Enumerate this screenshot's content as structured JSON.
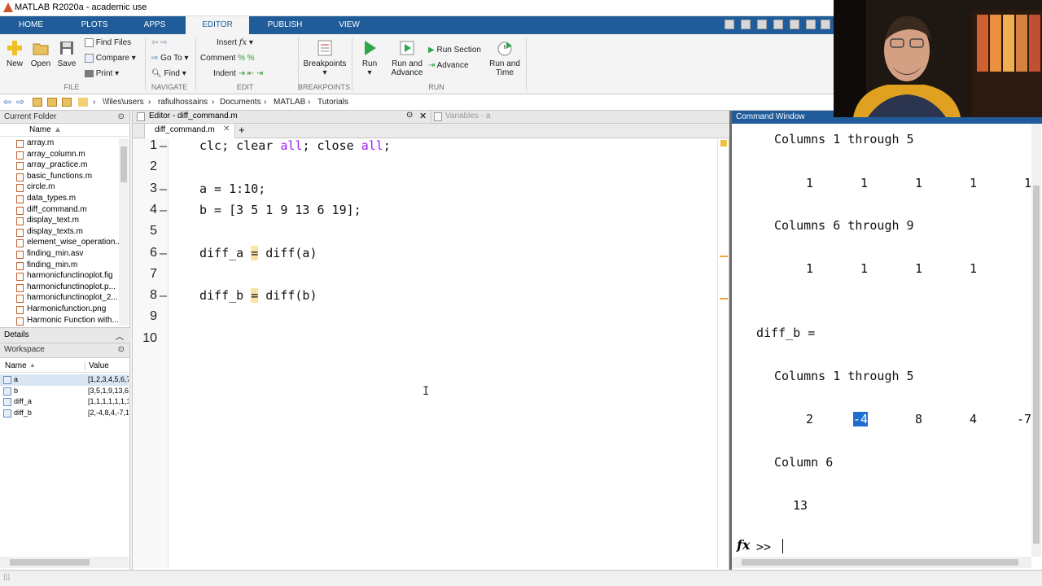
{
  "window": {
    "title": "MATLAB R2020a - academic use"
  },
  "tabs": [
    {
      "label": "HOME",
      "active": false
    },
    {
      "label": "PLOTS",
      "active": false
    },
    {
      "label": "APPS",
      "active": false
    },
    {
      "label": "EDITOR",
      "active": true
    },
    {
      "label": "PUBLISH",
      "active": false
    },
    {
      "label": "VIEW",
      "active": false
    }
  ],
  "ribbon": {
    "file": {
      "new": "New",
      "open": "Open",
      "save": "Save",
      "find_files": "Find Files",
      "compare": "Compare",
      "print": "Print",
      "group": "FILE"
    },
    "navigate": {
      "go_to": "Go To",
      "find": "Find",
      "group": "NAVIGATE"
    },
    "edit": {
      "insert": "Insert",
      "comment": "Comment",
      "indent": "Indent",
      "group": "EDIT"
    },
    "breakpoints": {
      "label": "Breakpoints",
      "group": "BREAKPOINTS"
    },
    "run": {
      "run": "Run",
      "run_advance_1": "Run and",
      "run_advance_2": "Advance",
      "run_section": "Run Section",
      "advance": "Advance",
      "run_time_1": "Run and",
      "run_time_2": "Time",
      "group": "RUN"
    }
  },
  "address": {
    "path": [
      "\\\\files\\users",
      "rafiulhossains",
      "Documents",
      "MATLAB",
      "Tutorials"
    ]
  },
  "current_folder": {
    "title": "Current Folder",
    "column": "Name",
    "files": [
      "array.m",
      "array_column.m",
      "array_practice.m",
      "basic_functions.m",
      "circle.m",
      "data_types.m",
      "diff_command.m",
      "display_text.m",
      "display_texts.m",
      "element_wise_operation...",
      "finding_min.asv",
      "finding_min.m",
      "harmonicfunctinoplot.fig",
      "harmonicfunctinoplot.p...",
      "harmonicfunctinoplot_2...",
      "Harmonicfunction.png",
      "Harmonic Function with..."
    ]
  },
  "details": {
    "title": "Details"
  },
  "workspace": {
    "title": "Workspace",
    "col_name": "Name",
    "col_value": "Value",
    "vars": [
      {
        "name": "a",
        "value": "[1,2,3,4,5,6,7"
      },
      {
        "name": "b",
        "value": "[3,5,1,9,13,6"
      },
      {
        "name": "diff_a",
        "value": "[1,1,1,1,1,1,1"
      },
      {
        "name": "diff_b",
        "value": "[2,-4,8,4,-7,1"
      }
    ]
  },
  "editor": {
    "header": "Editor - diff_command.m",
    "variables_tab": "Variables - a",
    "file_tab": "diff_command.m",
    "lines": [
      {
        "num": "1",
        "dash": "—",
        "parts": [
          {
            "t": "clc; clear "
          },
          {
            "t": "all",
            "c": "kw"
          },
          {
            "t": "; close "
          },
          {
            "t": "all",
            "c": "kw"
          },
          {
            "t": ";"
          }
        ]
      },
      {
        "num": "2",
        "dash": "",
        "parts": []
      },
      {
        "num": "3",
        "dash": "—",
        "parts": [
          {
            "t": "a = 1:10;"
          }
        ]
      },
      {
        "num": "4",
        "dash": "—",
        "parts": [
          {
            "t": "b = [3 5 1 9 13 6 19];"
          }
        ]
      },
      {
        "num": "5",
        "dash": "",
        "parts": []
      },
      {
        "num": "6",
        "dash": "—",
        "parts": [
          {
            "t": "diff_a "
          },
          {
            "t": "=",
            "c": "hl"
          },
          {
            "t": " diff(a)"
          }
        ]
      },
      {
        "num": "7",
        "dash": "",
        "parts": []
      },
      {
        "num": "8",
        "dash": "—",
        "parts": [
          {
            "t": "diff_b "
          },
          {
            "t": "=",
            "c": "hl"
          },
          {
            "t": " diff(b)"
          }
        ]
      },
      {
        "num": "9",
        "dash": "",
        "parts": []
      },
      {
        "num": "10",
        "dash": "",
        "parts": []
      }
    ]
  },
  "command_window": {
    "title": "Command Window",
    "cols_1_5_a": "Columns 1 through 5",
    "row_a1": [
      "1",
      "1",
      "1",
      "1",
      "1"
    ],
    "cols_6_9": "Columns 6 through 9",
    "row_a2": [
      "1",
      "1",
      "1",
      "1"
    ],
    "diff_b_label": "diff_b =",
    "cols_1_5_b": "Columns 1 through 5",
    "row_b1": [
      "2",
      "-4",
      "8",
      "4",
      "-7"
    ],
    "col_6": "Column 6",
    "row_b2": "13",
    "prompt": ">>"
  }
}
